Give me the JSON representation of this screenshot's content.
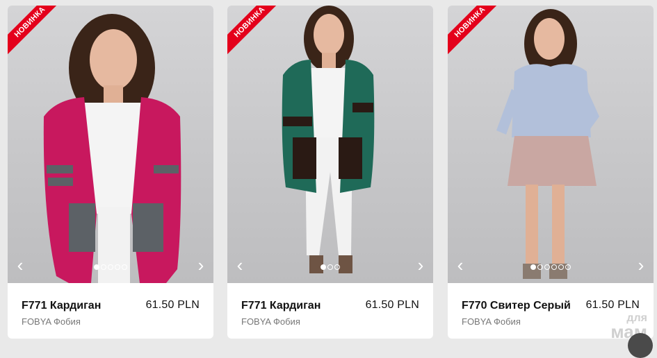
{
  "products": [
    {
      "badge": "НОВИНКА",
      "name": "F771 Кардиган",
      "price": "61.50  PLN",
      "brand": "FOBYA Фобия",
      "photo_slide": 1,
      "photo_count": 5,
      "colors": {
        "main": "#c8185e",
        "stripe": "#5c6166",
        "top": "#f4f4f4",
        "bottom": "#f2f2f2"
      }
    },
    {
      "badge": "НОВИНКА",
      "name": "F771 Кардиган",
      "price": "61.50  PLN",
      "brand": "FOBYA Фобия",
      "photo_slide": 1,
      "photo_count": 3,
      "colors": {
        "main": "#1f6a58",
        "stripe": "#2a1a14",
        "top": "#f4f4f4",
        "bottom": "#f2f2f2"
      }
    },
    {
      "badge": "НОВИНКА",
      "name": "F770 Свитер Серый",
      "price": "61.50  PLN",
      "brand": "FOBYA Фобия",
      "photo_slide": 1,
      "photo_count": 6,
      "colors": {
        "main": "#b2c0da",
        "stripe": "#b2c0da",
        "top": "#b2c0da",
        "bottom": "#c9a7a2"
      }
    }
  ],
  "icons": {
    "prev": "chevron-left-icon",
    "next": "chevron-right-icon"
  },
  "watermark": {
    "line1": "для",
    "line2": "мам"
  }
}
